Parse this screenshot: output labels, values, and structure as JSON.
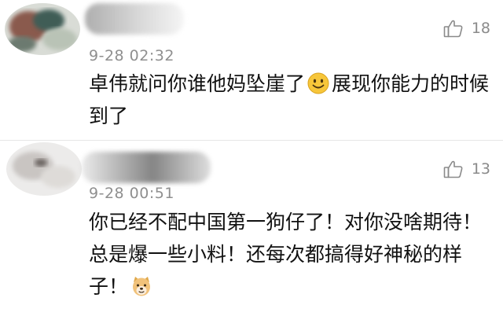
{
  "comments": [
    {
      "time": "9-28 02:32",
      "likes": "18",
      "text_before_emoji": "卓伟就问你谁他妈坠崖了",
      "emoji": "smile-emoji",
      "text_after_emoji": "展现你能力的时候到了"
    },
    {
      "time": "9-28 00:51",
      "likes": "13",
      "text_before_emoji": "你已经不配中国第一狗仔了！对你没啥期待！总是爆一些小料！还每次都搞得好神秘的样子！",
      "emoji": "doge-emoji",
      "text_after_emoji": ""
    }
  ],
  "colors": {
    "text": "#111111",
    "meta": "#8f8f8f",
    "divider": "#e6e6e6",
    "emoji_yellow": "#f7c63a"
  }
}
